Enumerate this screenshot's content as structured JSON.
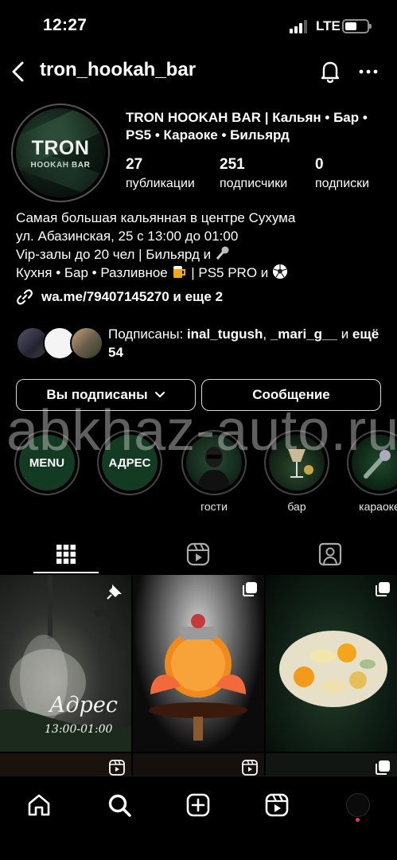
{
  "status_bar": {
    "time": "12:27",
    "network": "LTE",
    "battery_level": 0.55
  },
  "header": {
    "username": "tron_hookah_bar"
  },
  "avatar": {
    "title": "TRON",
    "subtitle": "HOOKAH BAR"
  },
  "profile": {
    "name": "TRON HOOKAH BAR | Кальян • Бар • PS5 • Караоке • Бильярд",
    "stats": [
      {
        "value": "27",
        "label": "публикации"
      },
      {
        "value": "251",
        "label": "подписчики"
      },
      {
        "value": "0",
        "label": "подписки"
      }
    ],
    "bio": [
      "Самая большая кальянная в центре Сухума",
      "ул. Абазинская, 25 с 13:00 до 01:00",
      "Vip-залы до 20 чел | Бильярд и",
      "Кухня • Бар • Разливное",
      "| PS5 PRO и"
    ],
    "link": "wa.me/79407145270 и еще 2"
  },
  "followed_by": {
    "prefix": "Подписаны:",
    "user1": "inal_tugush",
    "sep": ",",
    "user2": "_mari_g__",
    "and": "и",
    "more": "ещё 54"
  },
  "buttons": {
    "following": "Вы подписаны",
    "message": "Сообщение"
  },
  "watermark": "abkhaz-auto.ru",
  "highlights": [
    {
      "label": "",
      "cover_text": "MENU"
    },
    {
      "label": "",
      "cover_text": "АДРЕС"
    },
    {
      "label": "гости",
      "cover_text": ""
    },
    {
      "label": "бар",
      "cover_text": ""
    },
    {
      "label": "караоке",
      "cover_text": ""
    }
  ],
  "grid": {
    "post1_title": "Адрес",
    "post1_hours": "13:00-01:00"
  },
  "colors": {
    "background": "#000000",
    "text": "#ffffff",
    "notification_dot": "#ff2d55",
    "highlight_bg": "#133a22"
  }
}
